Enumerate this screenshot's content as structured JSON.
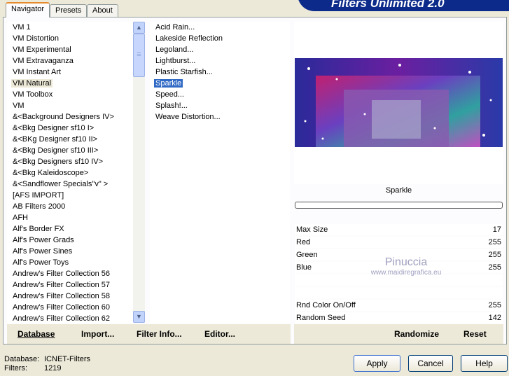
{
  "header": {
    "title": "Filters Unlimited 2.0"
  },
  "tabs": [
    {
      "label": "Navigator",
      "active": true
    },
    {
      "label": "Presets"
    },
    {
      "label": "About"
    }
  ],
  "categories": {
    "selected": "VM Natural",
    "items": [
      "VM 1",
      "VM Distortion",
      "VM Experimental",
      "VM Extravaganza",
      "VM Instant Art",
      "VM Natural",
      "VM Toolbox",
      "VM",
      "&<Background Designers IV>",
      "&<Bkg Designer sf10 I>",
      "&<BKg Designer sf10 II>",
      "&<Bkg Designer sf10 III>",
      "&<Bkg Designers sf10 IV>",
      "&<Bkg Kaleidoscope>",
      "&<Sandflower Specials\"v\" >",
      "[AFS IMPORT]",
      "AB Filters 2000",
      "AFH",
      "Alf's Border FX",
      "Alf's Power Grads",
      "Alf's Power Sines",
      "Alf's Power Toys",
      "Andrew's Filter Collection 56",
      "Andrew's Filter Collection 57",
      "Andrew's Filter Collection 58",
      "Andrew's Filter Collection 60",
      "Andrew's Filter Collection 62"
    ]
  },
  "filters": {
    "selected": "Sparkle",
    "items": [
      "Acid Rain...",
      "Lakeside Reflection",
      "Legoland...",
      "Lightburst...",
      "Plastic Starfish...",
      "Sparkle",
      "Speed...",
      "Splash!...",
      "Weave Distortion..."
    ]
  },
  "preview": {
    "filter_name": "Sparkle",
    "progress": 0
  },
  "params": [
    {
      "label": "Max Size",
      "value": "17"
    },
    {
      "label": "Red",
      "value": "255"
    },
    {
      "label": "Green",
      "value": "255"
    },
    {
      "label": "Blue",
      "value": "255"
    },
    {
      "label": "",
      "value": ""
    },
    {
      "label": "",
      "value": ""
    },
    {
      "label": "Rnd Color On/Off",
      "value": "255"
    },
    {
      "label": "Random Seed",
      "value": "142"
    }
  ],
  "watermark": {
    "name": "Pinuccia",
    "url": "www.maidiregrafica.eu"
  },
  "bottom_bar": {
    "database": "Database",
    "import": "Import...",
    "filter_info": "Filter Info...",
    "editor": "Editor...",
    "randomize": "Randomize",
    "reset": "Reset"
  },
  "status": {
    "database_label": "Database:",
    "database_value": "ICNET-Filters",
    "filters_label": "Filters:",
    "filters_value": "1219"
  },
  "buttons": {
    "apply": "Apply",
    "cancel": "Cancel",
    "help": "Help"
  }
}
